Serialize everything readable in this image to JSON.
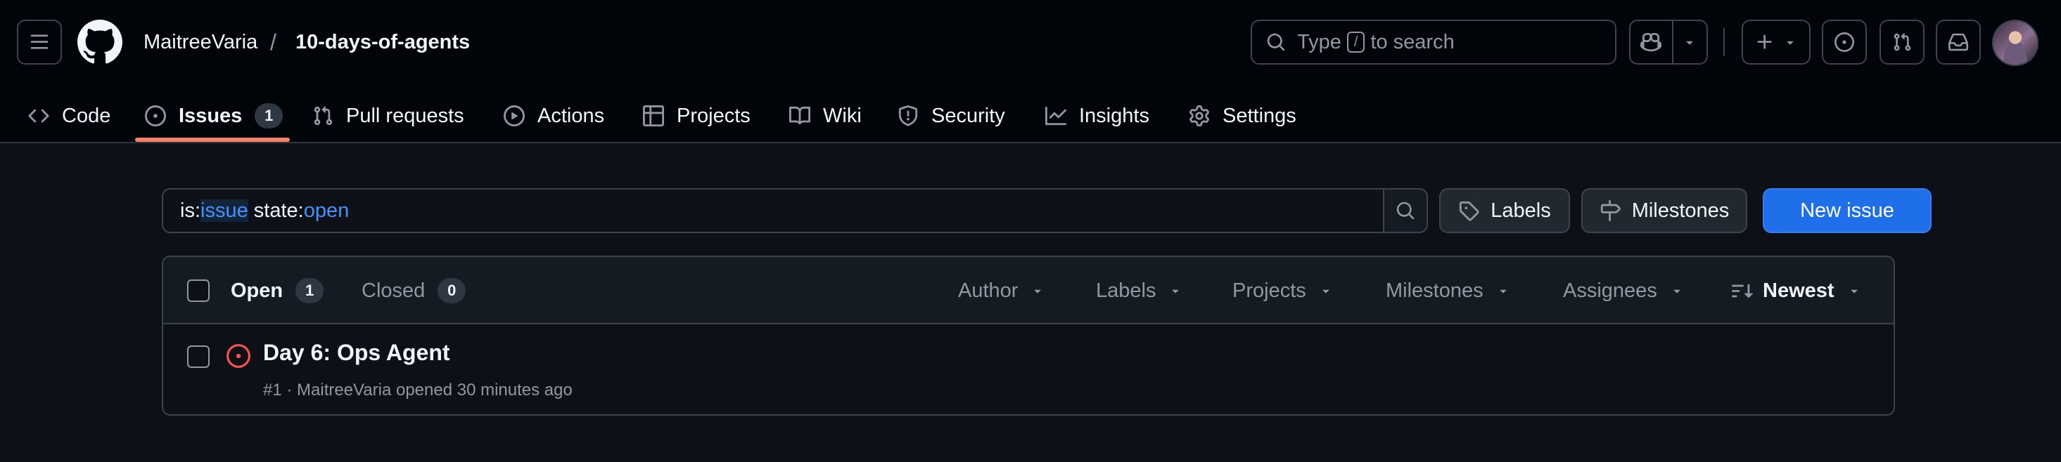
{
  "header": {
    "owner": "MaitreeVaria",
    "separator": "/",
    "repo": "10-days-of-agents",
    "search": {
      "prefix": "Type",
      "key": "/",
      "suffix": "to search"
    }
  },
  "repo_nav": {
    "items": [
      {
        "label": "Code",
        "icon": "code-icon"
      },
      {
        "label": "Issues",
        "icon": "issue-opened-icon",
        "count": "1",
        "selected": true
      },
      {
        "label": "Pull requests",
        "icon": "git-pull-request-icon"
      },
      {
        "label": "Actions",
        "icon": "play-icon"
      },
      {
        "label": "Projects",
        "icon": "table-icon"
      },
      {
        "label": "Wiki",
        "icon": "book-icon"
      },
      {
        "label": "Security",
        "icon": "shield-icon"
      },
      {
        "label": "Insights",
        "icon": "graph-icon"
      },
      {
        "label": "Settings",
        "icon": "gear-icon"
      }
    ]
  },
  "toolbar": {
    "filter": {
      "k1": "is:",
      "v1": "issue",
      "k2": " state:",
      "v2": "open"
    },
    "labels_label": "Labels",
    "milestones_label": "Milestones",
    "new_issue_label": "New issue"
  },
  "list": {
    "open_label": "Open",
    "open_count": "1",
    "closed_label": "Closed",
    "closed_count": "0",
    "filters": {
      "author": "Author",
      "labels": "Labels",
      "projects": "Projects",
      "milestones": "Milestones",
      "assignees": "Assignees",
      "sort": "Newest"
    },
    "issues": [
      {
        "title": "Day 6: Ops Agent",
        "meta": "#1 · MaitreeVaria opened 30 minutes ago"
      }
    ]
  },
  "colors": {
    "accent_underline": "#f78166",
    "open_issue": "#f85149",
    "primary_button": "#1f6feb",
    "highlight": "#4493f8"
  }
}
